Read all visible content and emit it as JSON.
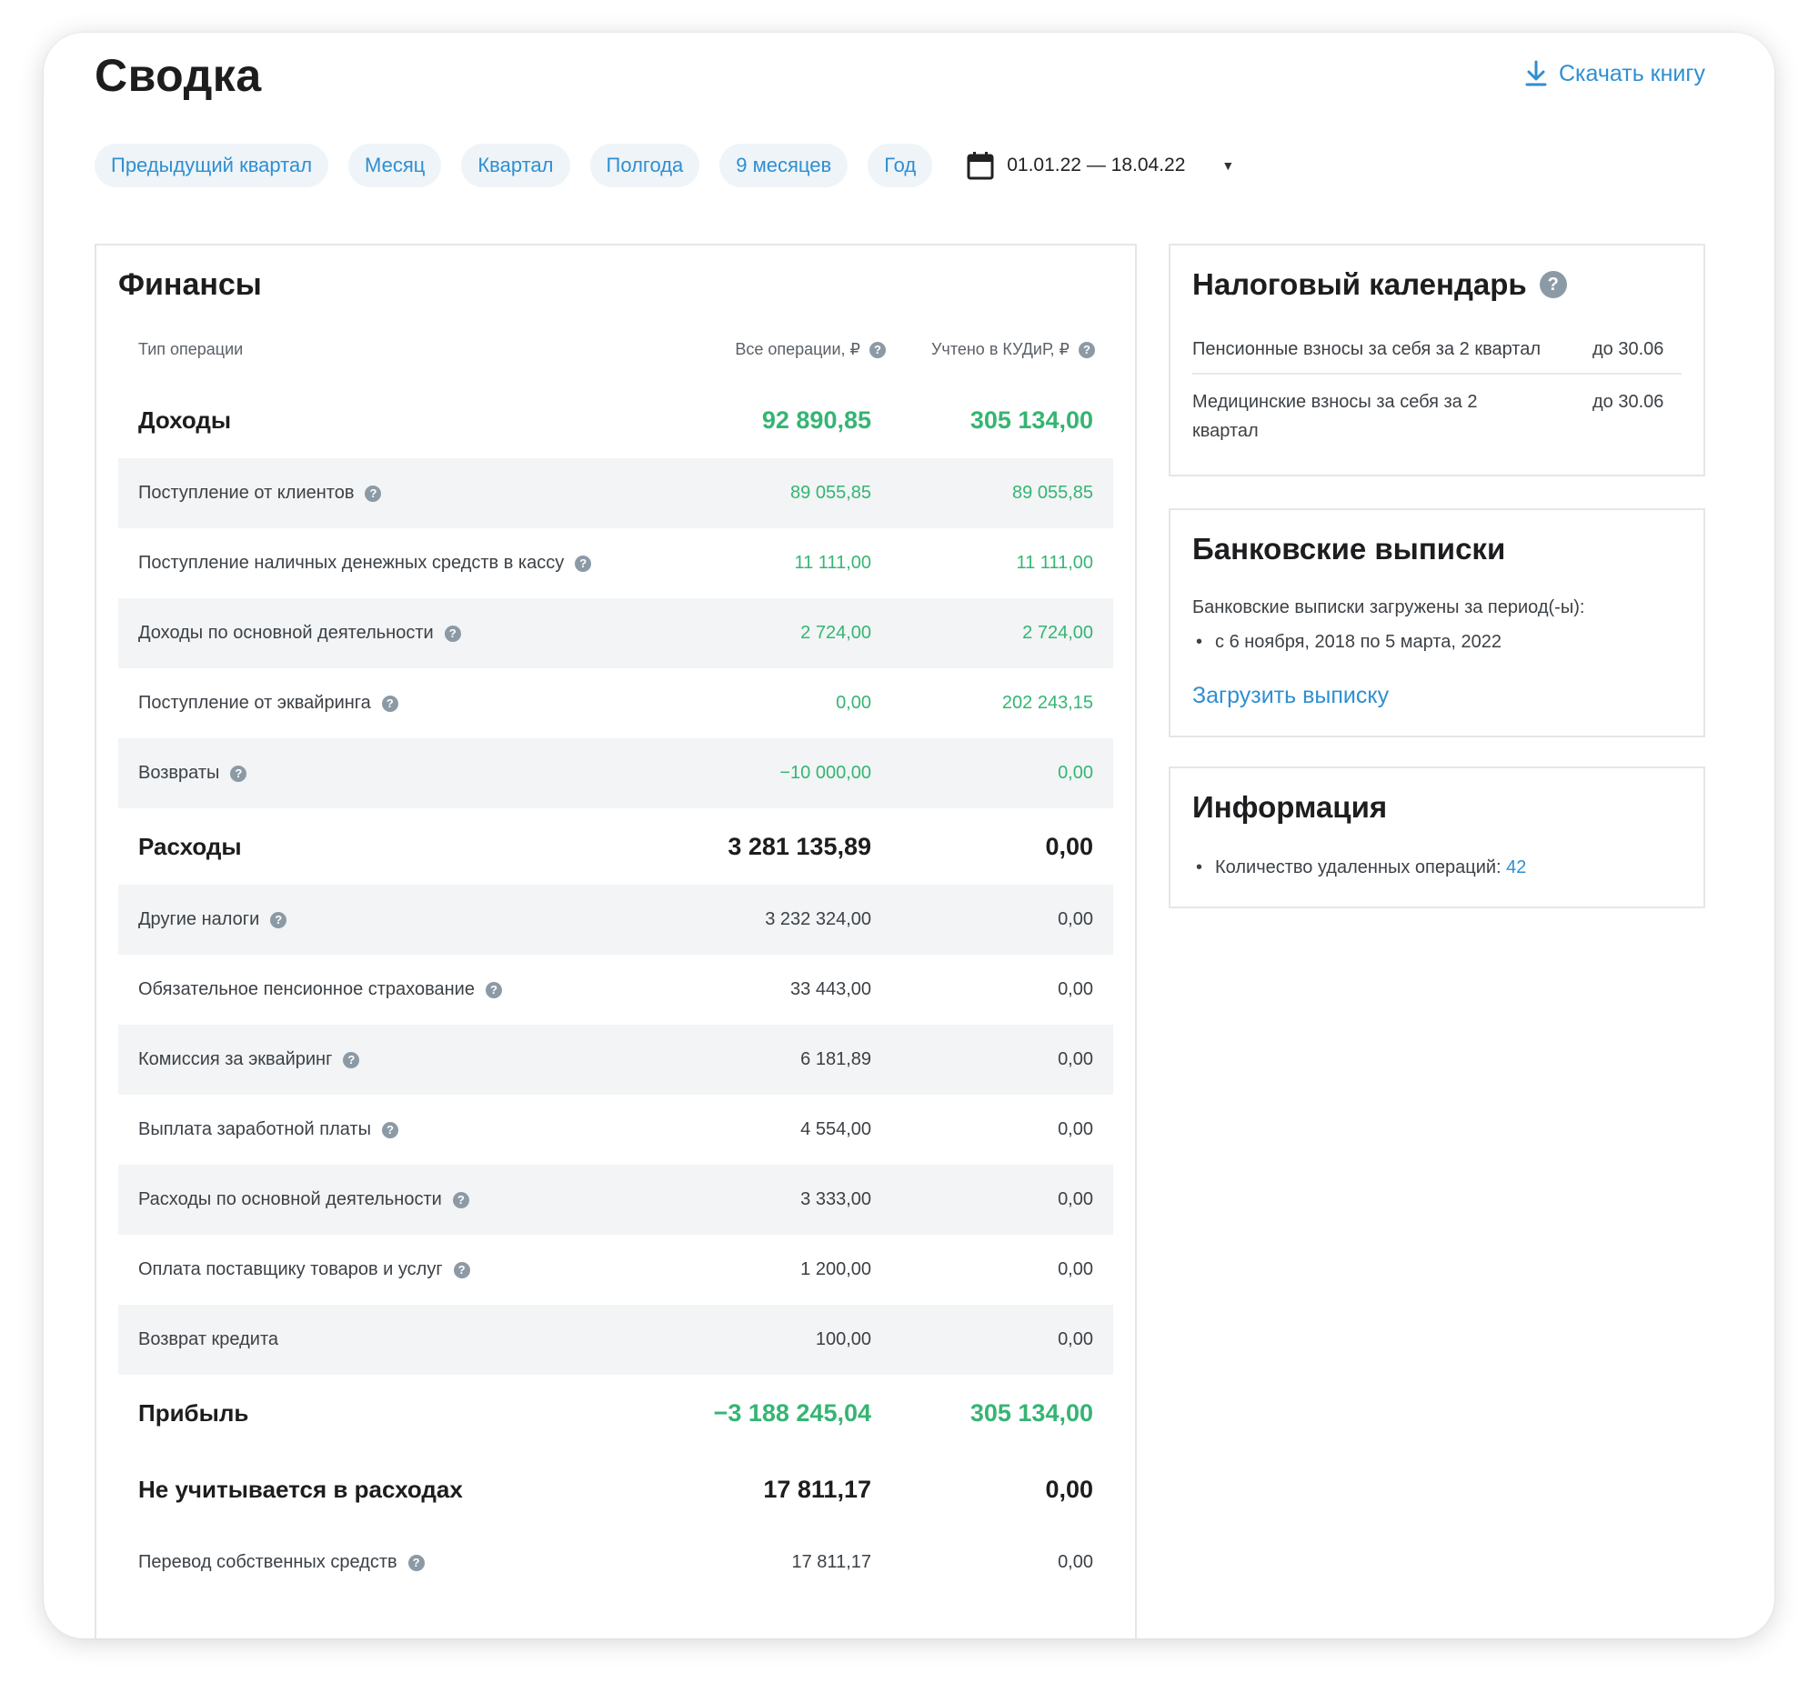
{
  "header": {
    "title": "Сводка",
    "download_label": "Скачать книгу"
  },
  "periods": [
    "Предыдущий квартал",
    "Месяц",
    "Квартал",
    "Полгода",
    "9 месяцев",
    "Год"
  ],
  "date_range": "01.01.22 — 18.04.22",
  "finance": {
    "title": "Финансы",
    "columns": {
      "type": "Тип операции",
      "all": "Все операции, ₽",
      "kudir": "Учтено в КУДиР, ₽"
    },
    "income": {
      "label": "Доходы",
      "all": "92 890,85",
      "kudir": "305 134,00",
      "rows": [
        {
          "label": "Поступление от клиентов",
          "all": "89 055,85",
          "kudir": "89 055,85"
        },
        {
          "label": "Поступление наличных денежных средств в кассу",
          "all": "11 111,00",
          "kudir": "11 111,00"
        },
        {
          "label": "Доходы по основной деятельности",
          "all": "2 724,00",
          "kudir": "2 724,00"
        },
        {
          "label": "Поступление от эквайринга",
          "all": "0,00",
          "kudir": "202 243,15"
        },
        {
          "label": "Возвраты",
          "all": "−10 000,00",
          "kudir": "0,00"
        }
      ]
    },
    "expenses": {
      "label": "Расходы",
      "all": "3 281 135,89",
      "kudir": "0,00",
      "rows": [
        {
          "label": "Другие налоги",
          "all": "3 232 324,00",
          "kudir": "0,00"
        },
        {
          "label": "Обязательное пенсионное страхование",
          "all": "33 443,00",
          "kudir": "0,00"
        },
        {
          "label": "Комиссия за эквайринг",
          "all": "6 181,89",
          "kudir": "0,00"
        },
        {
          "label": "Выплата заработной платы",
          "all": "4 554,00",
          "kudir": "0,00"
        },
        {
          "label": "Расходы по основной деятельности",
          "all": "3 333,00",
          "kudir": "0,00"
        },
        {
          "label": "Оплата поставщику товаров и услуг",
          "all": "1 200,00",
          "kudir": "0,00"
        },
        {
          "label": "Возврат кредита",
          "all": "100,00",
          "kudir": "0,00"
        }
      ]
    },
    "profit": {
      "label": "Прибыль",
      "all": "−3 188 245,04",
      "kudir": "305 134,00"
    },
    "not_counted": {
      "label": "Не учитывается в расходах",
      "all": "17 811,17",
      "kudir": "0,00",
      "rows": [
        {
          "label": "Перевод собственных средств",
          "all": "17 811,17",
          "kudir": "0,00"
        }
      ]
    }
  },
  "tax_calendar": {
    "title": "Налоговый календарь",
    "items": [
      {
        "text": "Пенсионные взносы за себя за 2 квартал",
        "due": "до 30.06"
      },
      {
        "text": "Медицинские взносы за себя за 2 квартал",
        "due": "до 30.06"
      }
    ]
  },
  "bank": {
    "title": "Банковские выписки",
    "text": "Банковские выписки загружены за период(-ы):",
    "period": "с 6 ноября, 2018 по 5 марта, 2022",
    "upload_label": "Загрузить выписку"
  },
  "info": {
    "title": "Информация",
    "deleted_label": "Количество удаленных операций:",
    "deleted_count": "42"
  },
  "colors": {
    "accent": "#2f8fd1",
    "positive": "#35b573",
    "row_shade": "#f2f4f5"
  }
}
